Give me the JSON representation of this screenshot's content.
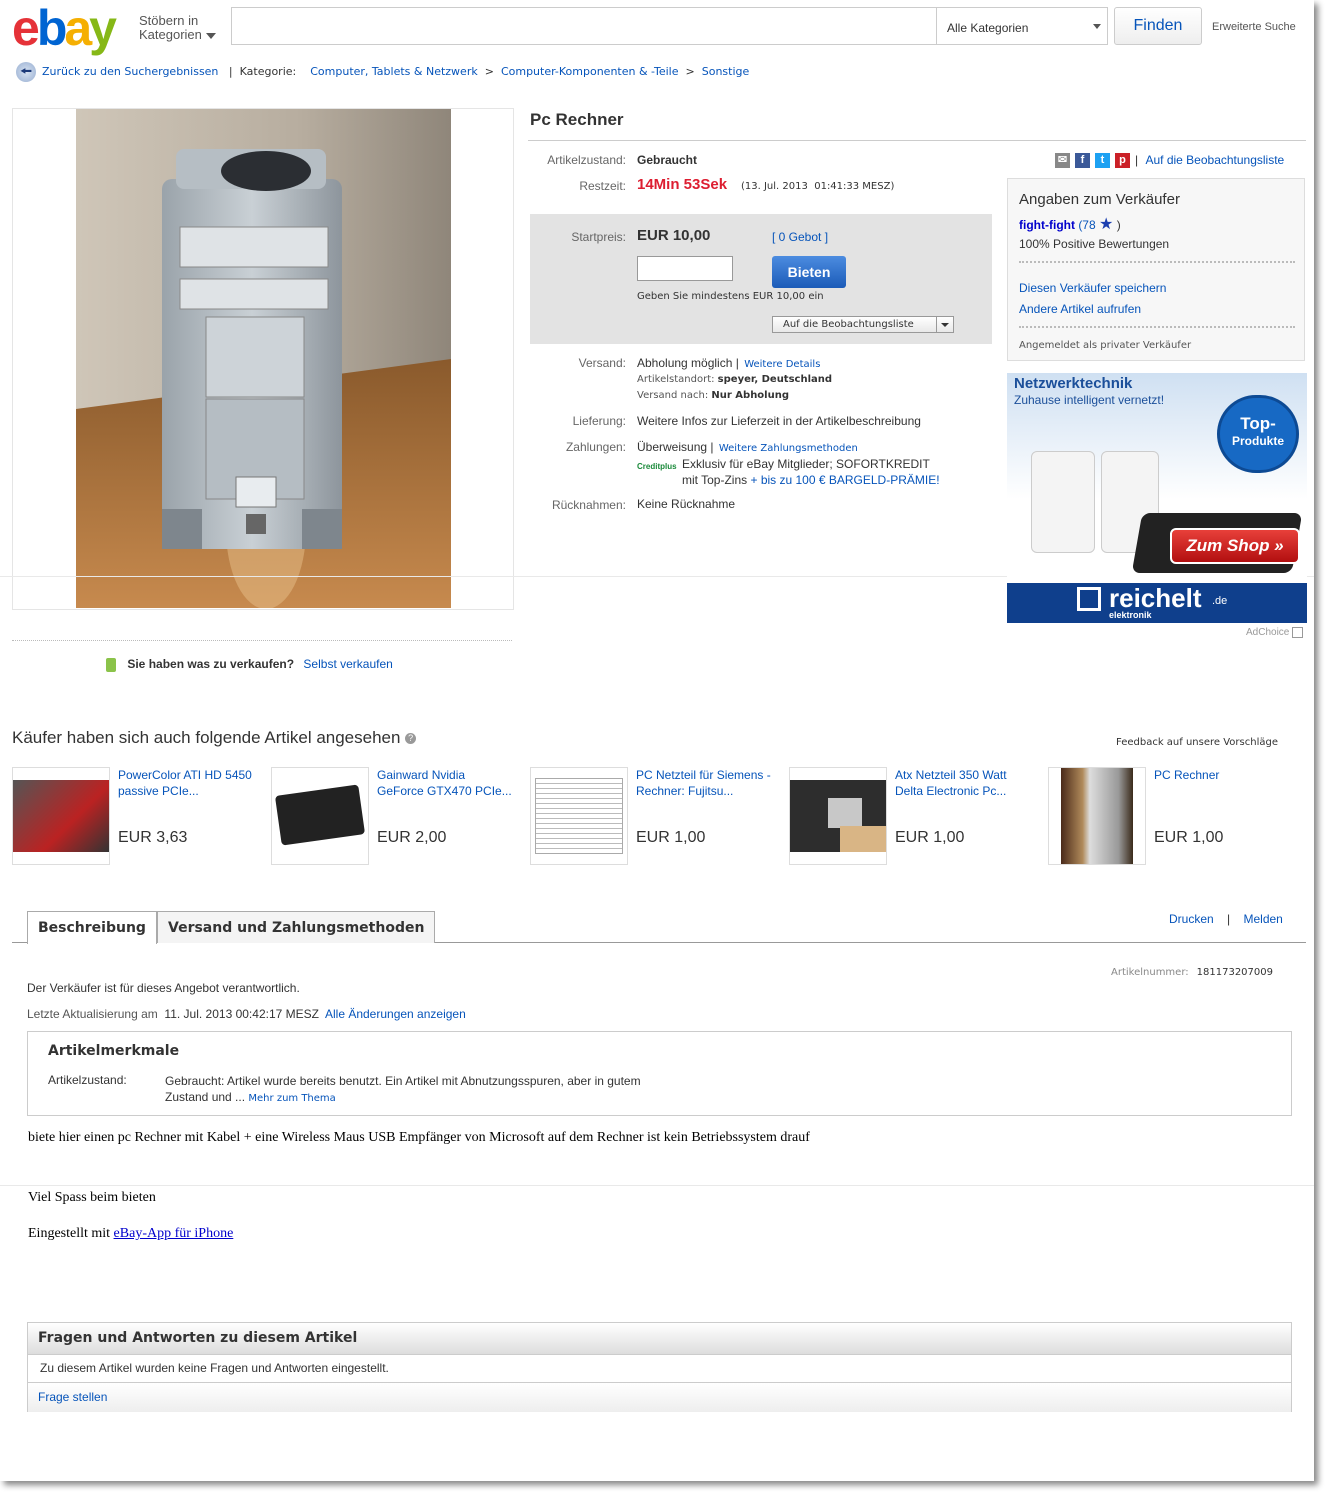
{
  "header": {
    "logo": [
      "e",
      "b",
      "a",
      "y"
    ],
    "browse_line1": "Stöbern in",
    "browse_line2": "Kategorien",
    "search_placeholder": "",
    "category_select": "Alle Kategorien",
    "find_button": "Finden",
    "advanced_search": "Erweiterte Suche"
  },
  "breadcrumb": {
    "back": "Zurück zu den Suchergebnissen",
    "category_label": "Kategorie:",
    "items": [
      "Computer, Tablets & Netzwerk",
      "Computer-Komponenten & -Teile",
      "Sonstige"
    ],
    "separator": ">"
  },
  "item": {
    "title": "Pc Rechner",
    "condition_label": "Artikelzustand:",
    "condition": "Gebraucht",
    "watchlist_link": "Auf die Beobachtungsliste",
    "time_label": "Restzeit:",
    "time_left": "14Min 53Sek",
    "end_time": "(13. Jul. 2013  01:41:33 MESZ)",
    "start_price_label": "Startpreis:",
    "start_price": "EUR 10,00",
    "bids": "[ 0 Gebot ]",
    "bid_button": "Bieten",
    "min_bid_hint": "Geben Sie mindestens EUR 10,00 ein",
    "watch_button": "Auf die Beobachtungsliste",
    "shipping_label": "Versand:",
    "shipping": "Abholung möglich |",
    "shipping_details": "Weitere Details",
    "location_label": "Artikelstandort:",
    "location": "speyer, Deutschland",
    "ships_to_label": "Versand nach:",
    "ships_to": "Nur Abholung",
    "delivery_label": "Lieferung:",
    "delivery": "Weitere Infos zur Lieferzeit in der Artikelbeschreibung",
    "payment_label": "Zahlungen:",
    "payment": "Überweisung  |",
    "payment_more": "Weitere Zahlungsmethoden",
    "creditplus": "Creditplus",
    "credit_line1": "Exklusiv für eBay Mitglieder; SOFORTKREDIT",
    "credit_line2": "mit Top-Zins",
    "credit_bonus": "+ bis zu 100 € BARGELD-PRÄMIE!",
    "returns_label": "Rücknahmen:",
    "returns": "Keine Rücknahme"
  },
  "seller": {
    "heading": "Angaben zum Verkäufer",
    "name": "fight-fight",
    "score_open": "(78",
    "score_close": ")",
    "positive": "100% Positive Bewertungen",
    "save": "Diesen Verkäufer speichern",
    "other_items": "Andere Artikel aufrufen",
    "private": "Angemeldet als privater Verkäufer"
  },
  "ad": {
    "headline": "Netzwerktechnik",
    "subline": "Zuhause intelligent vernetzt!",
    "badge_line1": "Top-",
    "badge_line2": "Produkte",
    "shop_button": "Zum Shop »",
    "brand": "reichelt",
    "brand_tld": ".de",
    "brand_sub": "elektronik",
    "adchoice": "AdChoice"
  },
  "sell": {
    "question": "Sie haben was zu verkaufen?",
    "link": "Selbst verkaufen"
  },
  "recommendations": {
    "heading": "Käufer haben sich auch folgende Artikel angesehen",
    "feedback": "Feedback auf unsere Vorschläge",
    "items": [
      {
        "title": "PowerColor ATI HD 5450 passive PCIe...",
        "price": "EUR 3,63"
      },
      {
        "title": "Gainward Nvidia GeForce GTX470 PCIe...",
        "price": "EUR 2,00"
      },
      {
        "title": "PC Netzteil für Siemens - Rechner: Fujitsu...",
        "price": "EUR 1,00"
      },
      {
        "title": "Atx Netzteil 350 Watt Delta Electronic Pc...",
        "price": "EUR 1,00"
      },
      {
        "title": "PC Rechner",
        "price": "EUR 1,00"
      }
    ]
  },
  "tabs": {
    "description": "Beschreibung",
    "shipping": "Versand und Zahlungsmethoden",
    "print": "Drucken",
    "separator": "|",
    "report": "Melden"
  },
  "description": {
    "item_number_label": "Artikelnummer:",
    "item_number": "181173207009",
    "responsible": "Der Verkäufer ist für dieses Angebot verantwortlich.",
    "last_update_label": "Letzte Aktualisierung am",
    "last_update": "11. Jul. 2013 00:42:17 MESZ",
    "all_changes": "Alle Änderungen anzeigen",
    "features_heading": "Artikelmerkmale",
    "feature_label": "Artikelzustand:",
    "feature_line1": "Gebraucht: Artikel wurde bereits benutzt. Ein Artikel mit Abnutzungsspuren, aber in gutem",
    "feature_line2": "Zustand und ...",
    "feature_more": "Mehr zum Thema",
    "text1": "biete hier einen pc Rechner mit Kabel + eine Wireless Maus USB Empfänger von Microsoft auf dem Rechner ist kein Betriebssystem drauf",
    "text2": "Viel Spass beim bieten",
    "text3": "Eingestellt mit",
    "text3_link": "eBay-App für iPhone"
  },
  "qa": {
    "heading": "Fragen und Antworten zu diesem Artikel",
    "empty": "Zu diesem Artikel wurden keine Fragen und Antworten eingestellt.",
    "ask": "Frage stellen"
  },
  "colors": {
    "ebay_e": "#e53238",
    "ebay_b": "#0064d2",
    "ebay_a": "#f5af02",
    "ebay_y": "#86b817",
    "link": "#0654ba",
    "time_red": "#dd1e31"
  }
}
